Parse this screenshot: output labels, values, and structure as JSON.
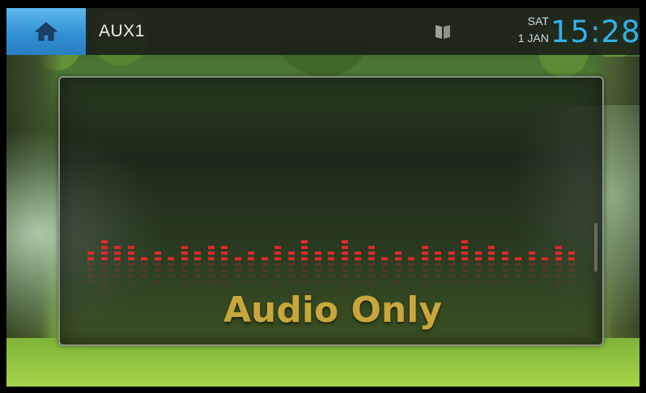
{
  "statusbar": {
    "home_icon": "home-icon",
    "source": "AUX1",
    "book_icon": "book-icon",
    "day": "SAT",
    "date": "1 JAN",
    "time": "15:28"
  },
  "panel": {
    "label": "Audio Only",
    "equalizer_levels": [
      2,
      4,
      3,
      3,
      1,
      2,
      1,
      3,
      2,
      3,
      3,
      1,
      2,
      1,
      3,
      2,
      4,
      2,
      2,
      4,
      2,
      3,
      1,
      2,
      1,
      3,
      2,
      2,
      4,
      2,
      3,
      2,
      1,
      2,
      1,
      3,
      2
    ]
  },
  "colors": {
    "accent": "#33b0ea",
    "home_button": "#2f8ed2",
    "label_gold": "#c9a63c",
    "equalizer_red": "#e0282a"
  }
}
